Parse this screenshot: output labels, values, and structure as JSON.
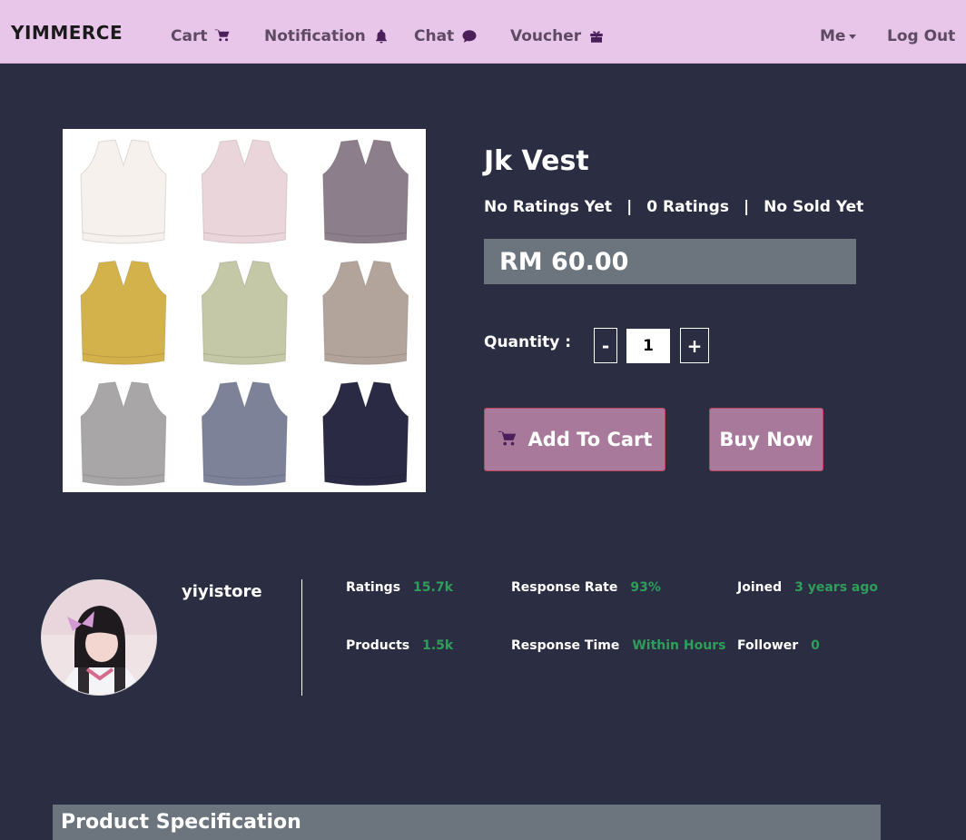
{
  "nav": {
    "brand": "YIMMERCE",
    "cart": "Cart",
    "notification": "Notification",
    "chat": "Chat",
    "voucher": "Voucher",
    "me": "Me",
    "logout": "Log Out"
  },
  "product": {
    "title": "Jk Vest",
    "rating_text": "No Ratings Yet",
    "ratings_count": "0 Ratings",
    "sold_text": "No Sold Yet",
    "separator": "|",
    "price": "RM 60.00",
    "quantity_label": "Quantity :",
    "quantity_value": "1",
    "minus": "-",
    "plus": "+",
    "add_to_cart": "Add To Cart",
    "buy_now": "Buy Now",
    "image_colors": [
      "#f6f1ec",
      "#ead5da",
      "#8c7e8a",
      "#d3b24c",
      "#c4c8a6",
      "#b3a49b",
      "#a8a6a6",
      "#7d8299",
      "#2a2a44"
    ]
  },
  "shop": {
    "name": "yiyistore",
    "ratings_label": "Ratings",
    "ratings_value": "15.7k",
    "response_rate_label": "Response Rate",
    "response_rate_value": "93%",
    "joined_label": "Joined",
    "joined_value": "3 years ago",
    "products_label": "Products",
    "products_value": "1.5k",
    "response_time_label": "Response Time",
    "response_time_value": "Within Hours",
    "follower_label": "Follower",
    "follower_value": "0"
  },
  "spec": {
    "title": "Product Specification"
  },
  "icons": {
    "cart": "cart-icon",
    "notification": "bell-icon",
    "chat": "chat-bubble-icon",
    "voucher": "gift-icon"
  },
  "colors": {
    "navbar": "#e8c6ea",
    "background": "#2b2d42",
    "price_box": "#6c757d",
    "button": "#a8799a",
    "accent_green": "#2f9e5a"
  }
}
